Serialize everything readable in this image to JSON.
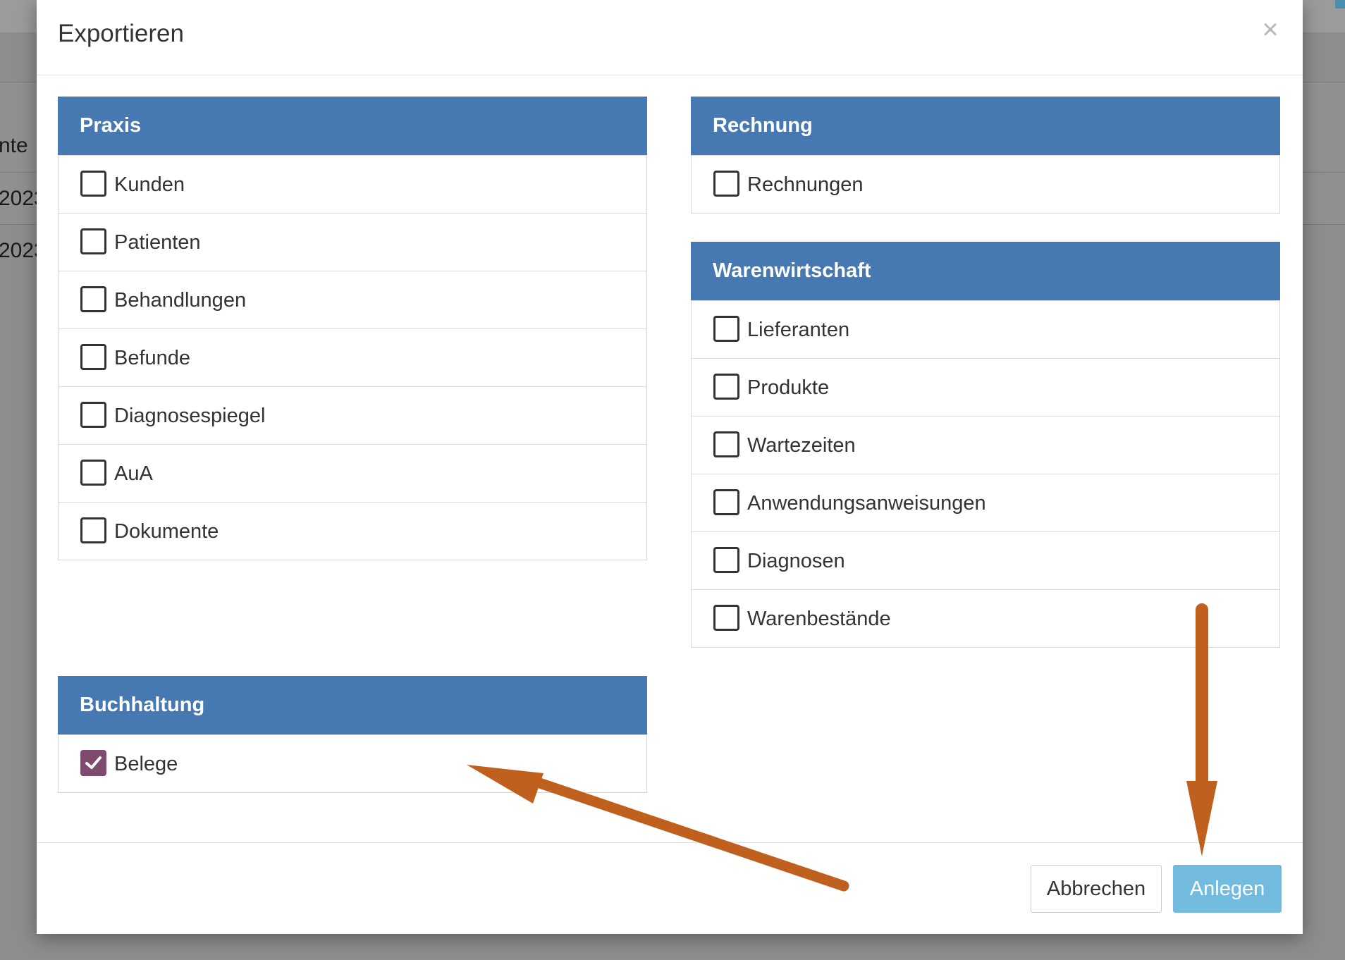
{
  "background": {
    "column_header": "nte",
    "rows": [
      "2023",
      "2023"
    ]
  },
  "modal": {
    "title": "Exportieren",
    "close_symbol": "×",
    "panels": {
      "praxis": {
        "title": "Praxis",
        "items": [
          {
            "label": "Kunden",
            "checked": false
          },
          {
            "label": "Patienten",
            "checked": false
          },
          {
            "label": "Behandlungen",
            "checked": false
          },
          {
            "label": "Befunde",
            "checked": false
          },
          {
            "label": "Diagnosespiegel",
            "checked": false
          },
          {
            "label": "AuA",
            "checked": false
          },
          {
            "label": "Dokumente",
            "checked": false
          }
        ]
      },
      "rechnung": {
        "title": "Rechnung",
        "items": [
          {
            "label": "Rechnungen",
            "checked": false
          }
        ]
      },
      "warenwirtschaft": {
        "title": "Warenwirtschaft",
        "items": [
          {
            "label": "Lieferanten",
            "checked": false
          },
          {
            "label": "Produkte",
            "checked": false
          },
          {
            "label": "Wartezeiten",
            "checked": false
          },
          {
            "label": "Anwendungsanweisungen",
            "checked": false
          },
          {
            "label": "Diagnosen",
            "checked": false
          },
          {
            "label": "Warenbestände",
            "checked": false
          }
        ]
      },
      "buchhaltung": {
        "title": "Buchhaltung",
        "items": [
          {
            "label": "Belege",
            "checked": true
          }
        ]
      }
    },
    "footer": {
      "cancel_label": "Abbrechen",
      "create_label": "Anlegen"
    }
  },
  "colors": {
    "panel_header": "#4678b2",
    "checkbox_checked": "#7e4b6f",
    "primary_button": "#73bce0",
    "annotation_arrow": "#c0601f"
  },
  "icons": {
    "close": "close-icon",
    "check": "checkmark-icon"
  }
}
